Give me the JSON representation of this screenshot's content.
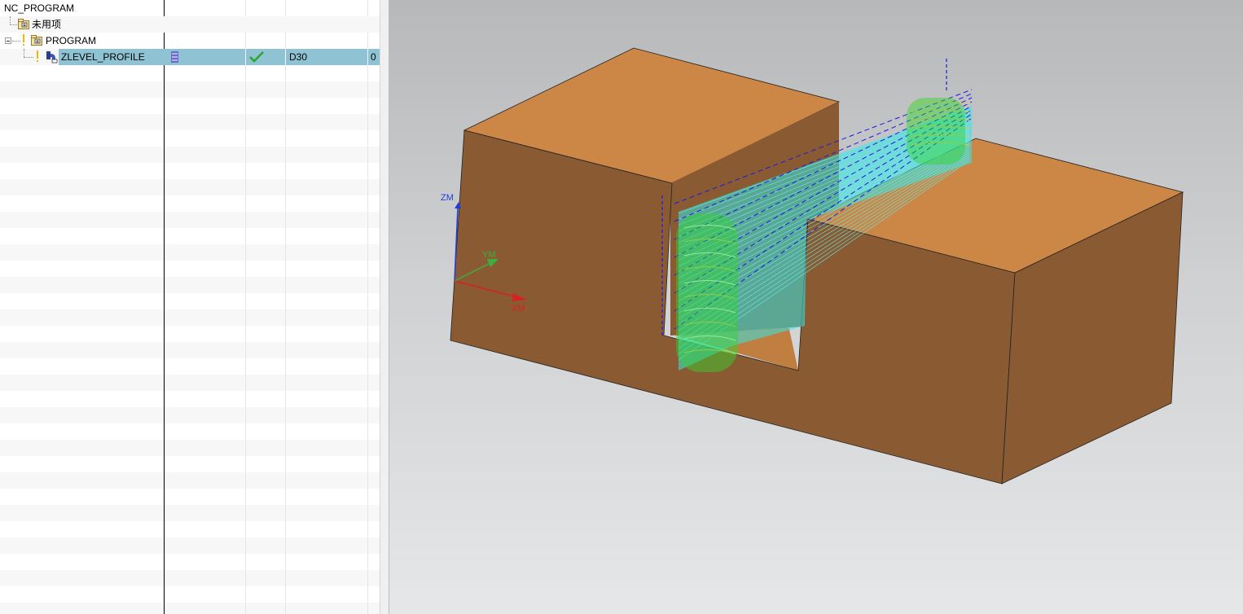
{
  "navigator": {
    "root_label": "NC_PROGRAM",
    "items": [
      {
        "label": "未用项",
        "icon": "program-group-icon"
      },
      {
        "label": "PROGRAM",
        "icon": "program-group-icon",
        "status": "warning"
      },
      {
        "label": "ZLEVEL_PROFILE",
        "icon": "zlevel-profile-operation-icon",
        "status": "warning",
        "path_icon": "toolpath-icon",
        "generated_icon": "checkmark-icon",
        "tool": "D30",
        "extra": "0",
        "selected": true
      }
    ]
  },
  "viewport": {
    "axes": {
      "z": "ZM",
      "y": "YM",
      "x": "XM"
    },
    "colors": {
      "workpiece_top": "#cc8746",
      "workpiece_side": "#8a5b32",
      "toolpath_cut": "#35e6e6",
      "toolpath_engage": "#2ed82e",
      "toolpath_rapid": "#1a1ae0",
      "axis_z": "#1f3fd8",
      "axis_y": "#3fae3f",
      "axis_x": "#d82020"
    }
  }
}
